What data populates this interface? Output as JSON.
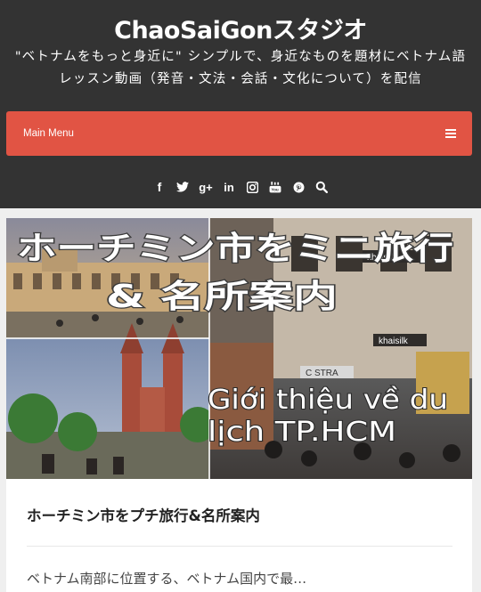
{
  "header": {
    "title": "ChaoSaiGonスタジオ",
    "description_line1": "\"ベトナムをもっと身近に\" シンプルで、身近なものを題材にベトナム語",
    "description_line2": "レッスン動画（発音・文法・会話・文化について）を配信"
  },
  "menu": {
    "label": "Main Menu",
    "toggle_icon": "hamburger-icon"
  },
  "social": {
    "icons": [
      "facebook-icon",
      "twitter-icon",
      "google-plus-icon",
      "linkedin-icon",
      "instagram-icon",
      "youtube-icon",
      "pinterest-icon",
      "search-icon"
    ],
    "facebook_glyph": "f",
    "google_glyph": "g+",
    "linkedin_glyph": "in"
  },
  "post": {
    "image": {
      "banner_line1": "ホーチミン市をミニ旅行",
      "banner_line2": "& 名所案内",
      "viet_line1": "Giới thiệu về  du",
      "viet_line2": "lịch TP.HCM",
      "shop_sign1": "khaisilk",
      "shop_sign2": "khaisilk",
      "shop_sign3": "C STRA"
    },
    "title": "ホーチミン市をプチ旅行&名所案内",
    "excerpt": "ベトナム南部に位置する、ベトナム国内で最…"
  },
  "colors": {
    "header_bg": "#333333",
    "accent": "#e15444",
    "page_bg": "#efefef"
  }
}
